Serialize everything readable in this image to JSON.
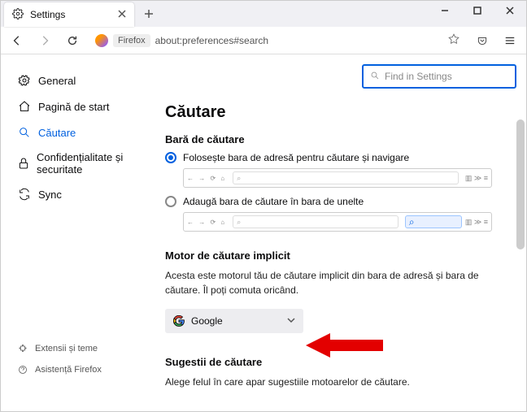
{
  "window": {
    "tab_title": "Settings",
    "url_scheme": "Firefox",
    "url": "about:preferences#search"
  },
  "find": {
    "placeholder": "Find in Settings"
  },
  "sidebar": {
    "items": [
      {
        "label": "General"
      },
      {
        "label": "Pagină de start"
      },
      {
        "label": "Căutare"
      },
      {
        "label": "Confidențialitate și securitate"
      },
      {
        "label": "Sync"
      }
    ],
    "footer": [
      {
        "label": "Extensii și teme"
      },
      {
        "label": "Asistență Firefox"
      }
    ]
  },
  "main": {
    "heading": "Căutare",
    "searchbar_heading": "Bară de căutare",
    "radio_inline": "Folosește bara de adresă pentru căutare și navigare",
    "radio_separate": "Adaugă bara de căutare în bara de unelte",
    "engine_heading": "Motor de căutare implicit",
    "engine_desc": "Acesta este motorul tău de căutare implicit din bara de adresă și bara de căutare. Îl poți comuta oricând.",
    "engine_selected": "Google",
    "suggest_heading": "Sugestii de căutare",
    "suggest_desc": "Alege felul în care apar sugestiile motoarelor de căutare."
  }
}
